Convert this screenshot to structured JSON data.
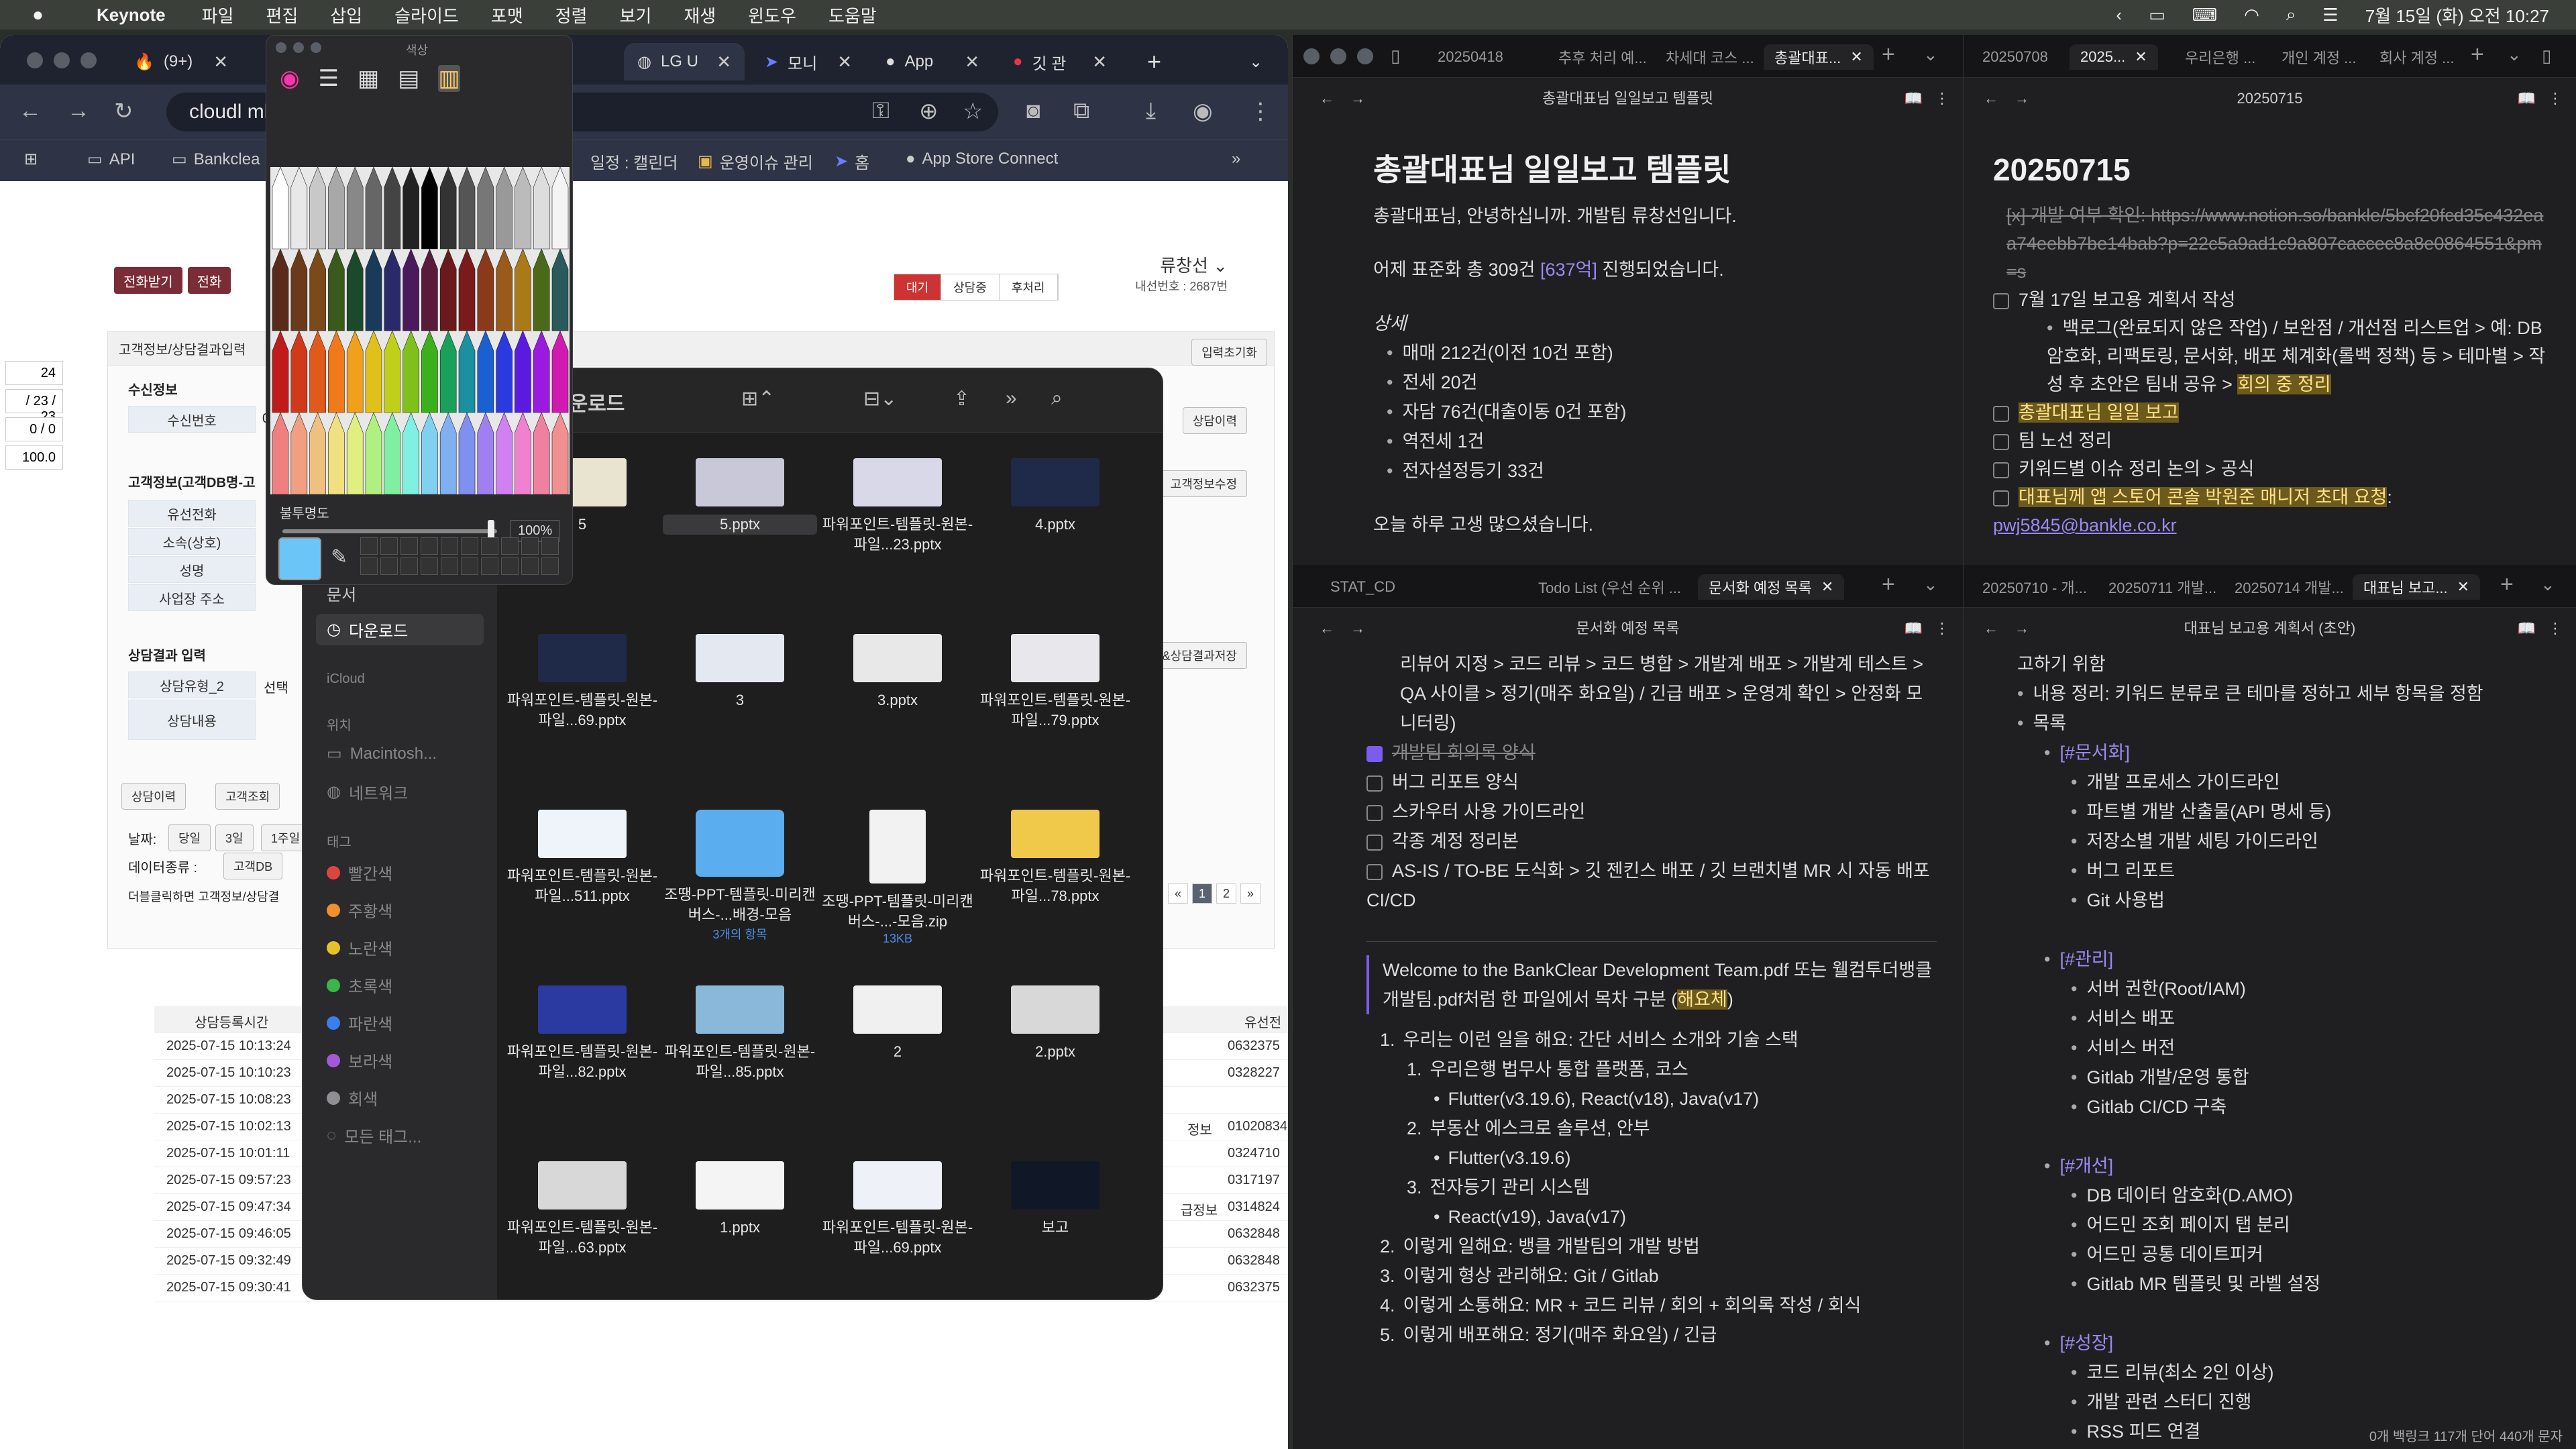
{
  "menubar": {
    "apple": "",
    "app": "Keynote",
    "items": [
      "파일",
      "편집",
      "삽입",
      "슬라이드",
      "포맷",
      "정렬",
      "보기",
      "재생",
      "윈도우",
      "도움말"
    ],
    "datetime": "7월 15일 (화) 오전 10:27"
  },
  "browser": {
    "tabs": [
      {
        "label": "(9+)"
      },
      {
        "label": "LG U"
      },
      {
        "label": "모니"
      },
      {
        "label": "App"
      },
      {
        "label": "깃 관"
      }
    ],
    "url": "cloudl                              mber.jsp#",
    "bookmarks": [
      "API",
      "Bankclea",
      "일정 : 캘린더",
      "운영이슈 관리",
      "홈",
      "App Store Connect"
    ],
    "page": {
      "btn1": "전화받기",
      "btn2": "전화",
      "seg": [
        "대기",
        "상담중",
        "후처리"
      ],
      "agent_name": "류창선",
      "agent_ext": "내선번호 : 2687번",
      "reset": "입력초기화",
      "consult_history": "상담이력",
      "cust_edit": "고객정보수정",
      "save": "수정&상담결과저장",
      "section_title": "고객정보/상담결과입력",
      "recv_info": "수신정보",
      "recv_no": "수신번호",
      "recv_val": "0",
      "cust_info": "고객정보(고객DB명-고",
      "fields": [
        "유선전화",
        "소속(상호)",
        "성명",
        "사업장 주소"
      ],
      "result_input": "상담결과 입력",
      "type_lbl": "상담유형_2",
      "type_val": "선택",
      "content_lbl": "상담내용",
      "left_vals": [
        "24",
        "/ 23 / 23",
        "0 / 0",
        "100.0"
      ],
      "tabs2": [
        "상담이력",
        "고객조회"
      ],
      "date_lbl": "날짜:",
      "date_opts": [
        "당일",
        "3일",
        "1주일"
      ],
      "dtype_lbl": "데이터종류 :",
      "dtype_val": "고객DB",
      "hint": "더블클릭하면 고객정보/상담결",
      "col_time": "상담등록시간",
      "col_phone": "유선전",
      "rows": [
        {
          "time": "2025-07-15 10:13:24",
          "phone": "0632375"
        },
        {
          "time": "2025-07-15 10:10:23",
          "phone": "0328227"
        },
        {
          "time": "2025-07-15 10:08:23",
          "phone": ""
        },
        {
          "time": "2025-07-15 10:02:13",
          "phone": "01020834",
          "note": "정보"
        },
        {
          "time": "2025-07-15 10:01:11",
          "phone": "0324710"
        },
        {
          "time": "2025-07-15 09:57:23",
          "phone": "0317197"
        },
        {
          "time": "2025-07-15 09:47:34",
          "phone": "0314824",
          "note": "급정보"
        },
        {
          "time": "2025-07-15 09:46:05",
          "phone": "0632848"
        },
        {
          "time": "2025-07-15 09:32:49",
          "phone": "0632848"
        },
        {
          "time": "2025-07-15 09:30:41",
          "phone": "0632375"
        }
      ],
      "pager": [
        "«",
        "1",
        "2",
        "»"
      ]
    }
  },
  "picker": {
    "title": "색상",
    "opacity_label": "불투명도",
    "opacity_value": "100%"
  },
  "finder": {
    "title": "다운로드",
    "sidebar": {
      "items": [
        "문서",
        "다운로드"
      ],
      "icloud": "iCloud",
      "location": "위치",
      "loc_items": [
        "Macintosh...",
        "네트워크"
      ],
      "tags_h": "태그",
      "tags": [
        {
          "name": "빨간색",
          "color": "#e0443e"
        },
        {
          "name": "주황색",
          "color": "#f0902a"
        },
        {
          "name": "노란색",
          "color": "#e6c229"
        },
        {
          "name": "초록색",
          "color": "#3cb54a"
        },
        {
          "name": "파란색",
          "color": "#3a7ff0"
        },
        {
          "name": "보라색",
          "color": "#a45ad8"
        },
        {
          "name": "회색",
          "color": "#8e8e93"
        }
      ],
      "all_tags": "모든 태그..."
    },
    "files": [
      {
        "name": "5",
        "sub": ""
      },
      {
        "name": "5.pptx",
        "sub": ""
      },
      {
        "name": "파워포인트-템플릿-원본-파일...23.pptx",
        "sub": ""
      },
      {
        "name": "4.pptx",
        "sub": ""
      },
      {
        "name": "파워포인트-템플릿-원본-파일...69.pptx",
        "sub": ""
      },
      {
        "name": "3",
        "sub": ""
      },
      {
        "name": "3.pptx",
        "sub": ""
      },
      {
        "name": "파워포인트-템플릿-원본-파일...79.pptx",
        "sub": ""
      },
      {
        "name": "파워포인트-템플릿-원본-파일...511.pptx",
        "sub": ""
      },
      {
        "name": "조땡-PPT-템플릿-미리캔버스-...배경-모음",
        "sub": "3개의 항목"
      },
      {
        "name": "조땡-PPT-템플릿-미리캔버스-...-모음.zip",
        "sub": "13KB"
      },
      {
        "name": "파워포인트-템플릿-원본-파일...78.pptx",
        "sub": ""
      },
      {
        "name": "파워포인트-템플릿-원본-파일...82.pptx",
        "sub": ""
      },
      {
        "name": "파워포인트-템플릿-원본-파일...85.pptx",
        "sub": ""
      },
      {
        "name": "2",
        "sub": ""
      },
      {
        "name": "2.pptx",
        "sub": ""
      },
      {
        "name": "파워포인트-템플릿-원본-파일...63.pptx",
        "sub": ""
      },
      {
        "name": "1.pptx",
        "sub": ""
      },
      {
        "name": "파워포인트-템플릿-원본-파일...69.pptx",
        "sub": ""
      },
      {
        "name": "보고",
        "sub": ""
      }
    ]
  },
  "note1": {
    "tabs": [
      "20250418",
      "추후 처리 예...",
      "차세대 코스 ...",
      "총괄대표..."
    ],
    "header": "총괄대표님 일일보고 템플릿",
    "title": "총괄대표님 일일보고 템플릿",
    "p1": "총괄대표님, 안녕하십니까. 개발팀 류창선입니다.",
    "p2a": "어제 표준화 총 309건 ",
    "p2b": "[637억]",
    "p2c": " 진행되었습니다.",
    "detail": "상세",
    "items": [
      "매매 212건(이전 10건 포함)",
      "전세 20건",
      "자담 76건(대출이동 0건 포함)",
      "역전세 1건",
      "전자설정등기 33건"
    ],
    "p3": "오늘 하루 고생 많으셨습니다."
  },
  "note2": {
    "tabs": [
      "STAT_CD",
      "Todo List (우선 순위 ...",
      "문서화 예정 목록"
    ],
    "header": "문서화 예정 목록",
    "intro": "리뷰어 지정 > 코드 리뷰 > 코드 병합 > 개발계 배포 > 개발계 테스트 > QA 사이클 > 정기(매주 화요일) / 긴급 배포 > 운영계 확인 > 안정화 모니터링)",
    "todos": [
      {
        "t": "개발팀 회의록 양식",
        "done": true
      },
      {
        "t": "버그 리포트 양식",
        "done": false
      },
      {
        "t": "스카우터 사용 가이드라인",
        "done": false
      },
      {
        "t": "각종 계정 정리본",
        "done": false
      },
      {
        "t": "AS-IS / TO-BE 도식화 > 깃 젠킨스 배포 / 깃 브랜치별 MR 시 자동 배포 CI/CD",
        "done": false
      }
    ],
    "quote_a": "Welcome to the BankClear Development Team.pdf 또는 웰컴투더뱅클개발팀.pdf처럼 한 파일에서 목차 구분 (",
    "quote_b": "해요체",
    "quote_c": ")",
    "ol": [
      {
        "n": "1.",
        "t": "우리는 이런 일을 해요: 간단 서비스 소개와 기술 스택",
        "lvl": 1
      },
      {
        "n": "1.",
        "t": "우리은행 법무사 통합 플랫폼, 코스",
        "lvl": 2
      },
      {
        "n": "•",
        "t": "Flutter(v3.19.6), React(v18), Java(v17)",
        "lvl": 3
      },
      {
        "n": "2.",
        "t": "부동산 에스크로 솔루션, 안부",
        "lvl": 2
      },
      {
        "n": "•",
        "t": "Flutter(v3.19.6)",
        "lvl": 3
      },
      {
        "n": "3.",
        "t": "전자등기 관리 시스템",
        "lvl": 2
      },
      {
        "n": "•",
        "t": "React(v19), Java(v17)",
        "lvl": 3
      },
      {
        "n": "2.",
        "t": "이렇게 일해요: 뱅클 개발팀의 개발 방법",
        "lvl": 1
      },
      {
        "n": "3.",
        "t": "이렇게 형상 관리해요: Git / Gitlab",
        "lvl": 1
      },
      {
        "n": "4.",
        "t": "이렇게 소통해요: MR + 코드 리뷰 / 회의 + 회의록 작성 / 회식",
        "lvl": 1
      },
      {
        "n": "5.",
        "t": "이렇게 배포해요: 정기(매주 화요일) / 긴급",
        "lvl": 1
      }
    ]
  },
  "note3": {
    "tabs": [
      "20250708",
      "2025...",
      "우리은행 ...",
      "개인 계정 ...",
      "회사 계정 ..."
    ],
    "header": "20250715",
    "title": "20250715",
    "l1a": "[x] 개발 여부 확인: ",
    "l1b": "https://www.notion.so/bankle/5bcf20fcd35c432eaa74eebb7be14bab?p=22c5a9ad1c9a807caccec8a8e0864551&pm=s",
    "l2": "7월 17일 보고용 계획서 작성",
    "l2sub_a": "백로그(완료되지 않은 작업) / 보완점 / 개선점 리스트업 > 예: DB 암호화, 리팩토링, 문서화, 배포 체계화(롤백 정책) 등 > 테마별 > 작성 후 초안은 팀내 공유 > ",
    "l2sub_b": "회의 중 정리",
    "l3": "총괄대표님 일일 보고",
    "l4": "팀 노선 정리",
    "l5": "키워드별 이슈 정리 논의 > 공식",
    "l6a": "대표님께 앱 스토어 콘솔 박원준 매니저 초대 요청",
    "l6b": ": ",
    "l6c": "pwj5845@bankle.co.kr"
  },
  "note4": {
    "tabs": [
      "20250710 - 개...",
      "20250711 개발...",
      "20250714 개발...",
      "대표님 보고..."
    ],
    "header": "대표님 보고용 계획서 (초안)",
    "lines": [
      {
        "t": "고하기 위함",
        "lvl": 1,
        "b": false
      },
      {
        "t": "내용 정리: 키워드 분류로 큰 테마를 정하고 세부 항목을 정함",
        "lvl": 1,
        "b": true
      },
      {
        "t": "목록",
        "lvl": 1,
        "b": true
      },
      {
        "t": "[#문서화]",
        "lvl": 2,
        "b": true,
        "tag": true
      },
      {
        "t": "개발 프로세스 가이드라인",
        "lvl": 3,
        "b": true
      },
      {
        "t": "파트별 개발 산출물(API 명세 등)",
        "lvl": 3,
        "b": true
      },
      {
        "t": "저장소별 개발 세팅 가이드라인",
        "lvl": 3,
        "b": true
      },
      {
        "t": "버그 리포트",
        "lvl": 3,
        "b": true
      },
      {
        "t": "Git 사용법",
        "lvl": 3,
        "b": true
      },
      {
        "t": "",
        "lvl": 3,
        "b": false
      },
      {
        "t": "[#관리]",
        "lvl": 2,
        "b": true,
        "tag": true
      },
      {
        "t": "서버 권한(Root/IAM)",
        "lvl": 3,
        "b": true
      },
      {
        "t": "서비스 배포",
        "lvl": 3,
        "b": true
      },
      {
        "t": "서비스 버전",
        "lvl": 3,
        "b": true
      },
      {
        "t": "Gitlab 개발/운영 통합",
        "lvl": 3,
        "b": true
      },
      {
        "t": "Gitlab CI/CD 구축",
        "lvl": 3,
        "b": true
      },
      {
        "t": "",
        "lvl": 3,
        "b": false
      },
      {
        "t": "[#개선]",
        "lvl": 2,
        "b": true,
        "tag": true
      },
      {
        "t": "DB 데이터 암호화(D.AMO)",
        "lvl": 3,
        "b": true
      },
      {
        "t": "어드민 조회 페이지 탭 분리",
        "lvl": 3,
        "b": true
      },
      {
        "t": "어드민 공통 데이트피커",
        "lvl": 3,
        "b": true
      },
      {
        "t": "Gitlab MR 템플릿 및 라벨 설정",
        "lvl": 3,
        "b": true
      },
      {
        "t": "",
        "lvl": 3,
        "b": false
      },
      {
        "t": "[#성장]",
        "lvl": 2,
        "b": true,
        "tag": true
      },
      {
        "t": "코드 리뷰(최소 2인 이상)",
        "lvl": 3,
        "b": true
      },
      {
        "t": "개발 관련 스터디 진행",
        "lvl": 3,
        "b": true
      },
      {
        "t": "RSS 피드 연결",
        "lvl": 3,
        "b": true
      }
    ],
    "status": "0개 백링크     117개 단어   440개 문자"
  }
}
